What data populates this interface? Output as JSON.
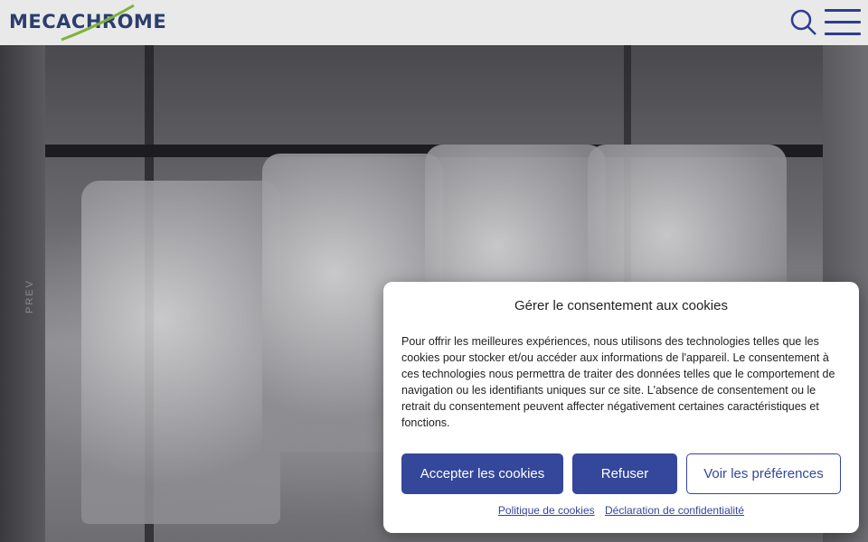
{
  "header": {
    "logo_text": "MECACHROME",
    "search_icon": "search-icon",
    "menu_icon": "hamburger-menu-icon"
  },
  "slider": {
    "prev_label": "PREV"
  },
  "cookie_dialog": {
    "title": "Gérer le consentement aux cookies",
    "body": "Pour offrir les meilleures expériences, nous utilisons des technologies telles que les cookies pour stocker et/ou accéder aux informations de l'appareil. Le consentement à ces technologies nous permettra de traiter des données telles que le comportement de navigation ou les identifiants uniques sur ce site. L'absence de consentement ou le retrait du consentement peuvent affecter négativement certaines caractéristiques et fonctions.",
    "accept_label": "Accepter les cookies",
    "refuse_label": "Refuser",
    "prefs_label": "Voir les préférences",
    "cookie_policy_link": "Politique de cookies",
    "privacy_link": "Déclaration de confidentialité"
  },
  "colors": {
    "brand_blue": "#34479a",
    "logo_green": "#7fb23a"
  }
}
